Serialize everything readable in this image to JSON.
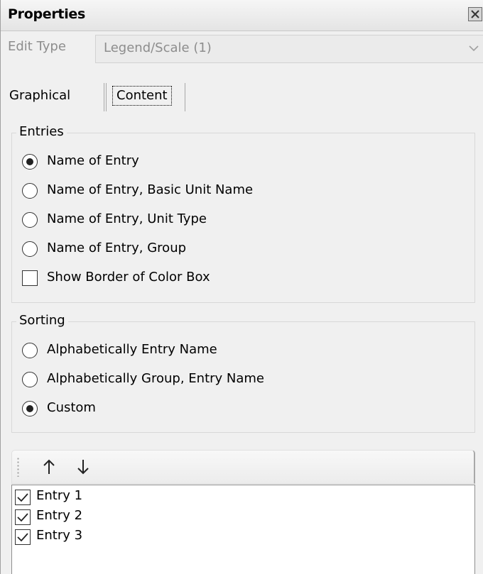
{
  "window": {
    "title": "Properties"
  },
  "edit_type": {
    "label": "Edit Type",
    "value": "Legend/Scale (1)"
  },
  "tabs": [
    {
      "label": "Graphical",
      "selected": false
    },
    {
      "label": "Content",
      "selected": true
    }
  ],
  "entries_group": {
    "title": "Entries",
    "options": [
      {
        "label": "Name of Entry",
        "checked": true
      },
      {
        "label": "Name of Entry, Basic Unit Name",
        "checked": false
      },
      {
        "label": "Name of Entry, Unit Type",
        "checked": false
      },
      {
        "label": "Name of Entry, Group",
        "checked": false
      }
    ],
    "show_border": {
      "label": "Show Border of Color Box",
      "checked": false
    }
  },
  "sorting_group": {
    "title": "Sorting",
    "options": [
      {
        "label": "Alphabetically Entry Name",
        "checked": false
      },
      {
        "label": "Alphabetically Group, Entry Name",
        "checked": false
      },
      {
        "label": "Custom",
        "checked": true
      }
    ]
  },
  "toolbar": {
    "up_icon": "arrow-up-icon",
    "down_icon": "arrow-down-icon"
  },
  "entry_list": [
    {
      "label": "Entry 1",
      "checked": true
    },
    {
      "label": "Entry 2",
      "checked": true
    },
    {
      "label": "Entry 3",
      "checked": true
    }
  ]
}
